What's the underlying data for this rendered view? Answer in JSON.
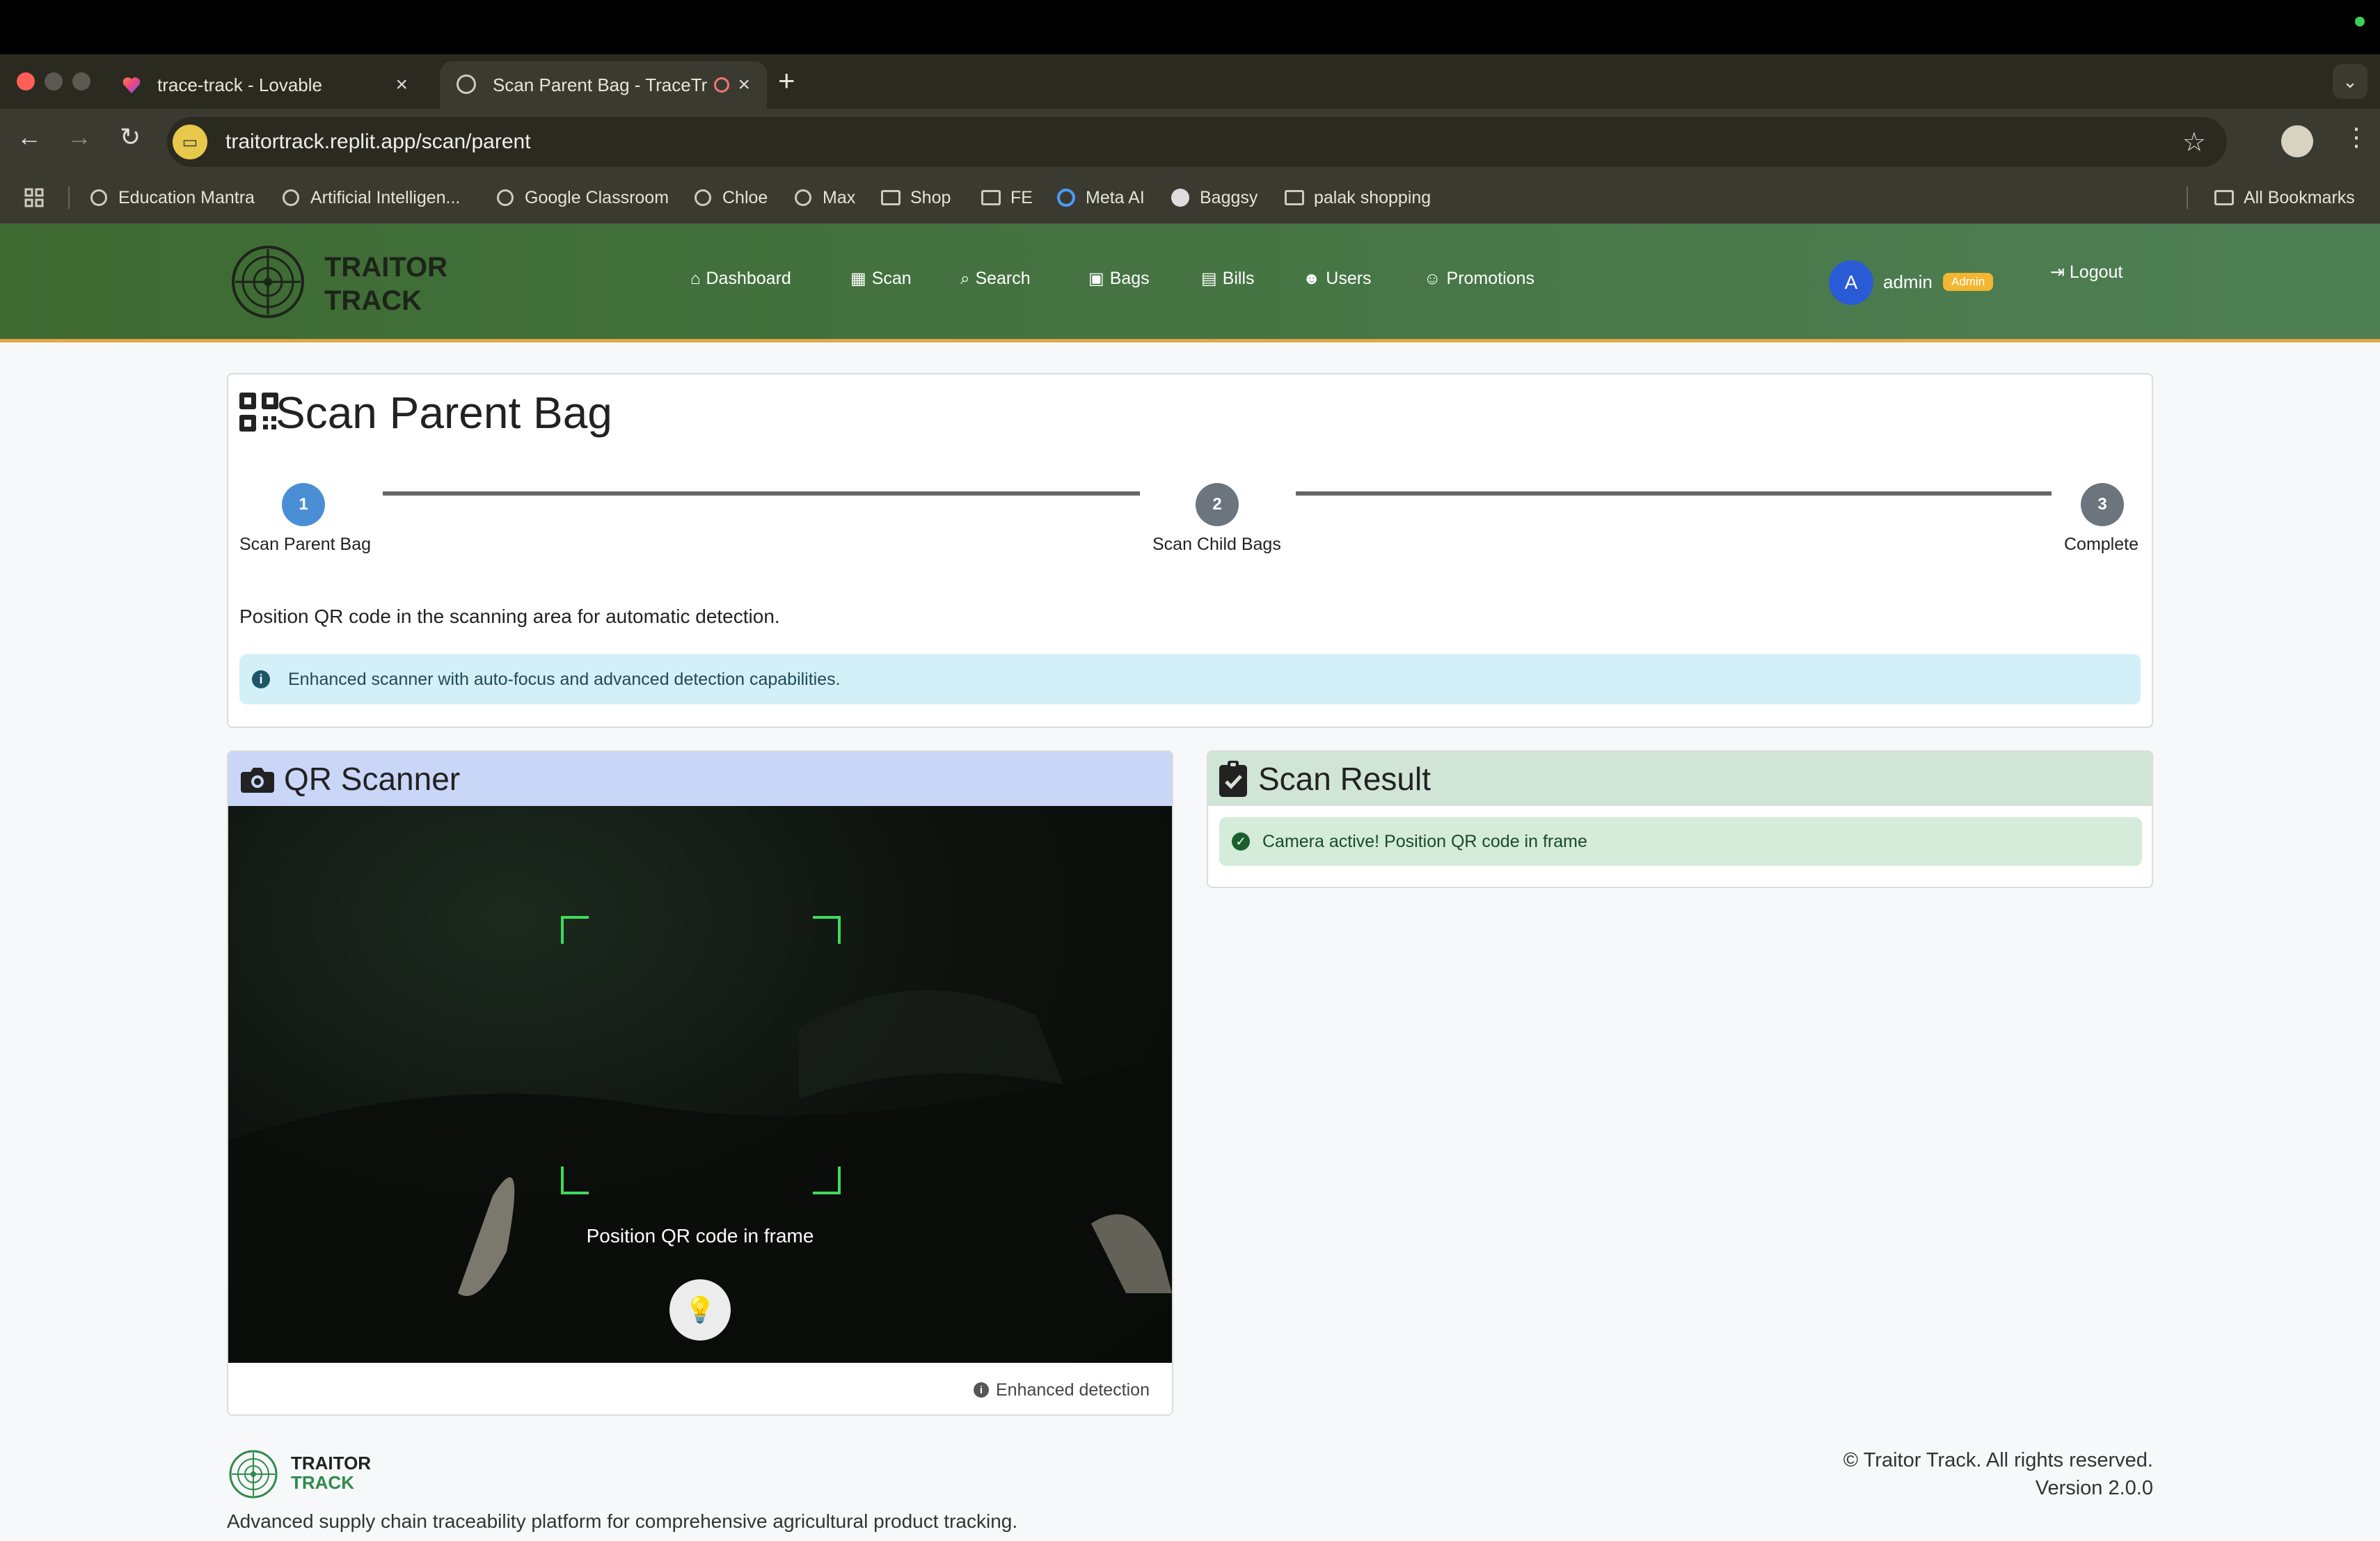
{
  "browser": {
    "tabs": [
      {
        "label": "trace-track - Lovable",
        "close": "×"
      },
      {
        "label": "Scan Parent Bag - TraceTr",
        "close": "×"
      }
    ],
    "new_tab": "+",
    "url": "traitortrack.replit.app/scan/parent",
    "bookmarks": [
      {
        "label": "Education Mantra",
        "icon": "globe-icon"
      },
      {
        "label": "Artificial Intelligen...",
        "icon": "globe-icon"
      },
      {
        "label": "Google Classroom",
        "icon": "globe-icon"
      },
      {
        "label": "Chloe",
        "icon": "globe-icon"
      },
      {
        "label": "Max",
        "icon": "globe-icon"
      },
      {
        "label": "Shop",
        "icon": "folder-icon"
      },
      {
        "label": "FE",
        "icon": "folder-icon"
      },
      {
        "label": "Meta AI",
        "icon": "meta-ai-icon"
      },
      {
        "label": "Baggsy",
        "icon": "openai-icon"
      },
      {
        "label": "palak shopping",
        "icon": "folder-icon"
      }
    ],
    "all_bookmarks": "All Bookmarks"
  },
  "app": {
    "brand_line1": "TRAITOR",
    "brand_line2": "TRACK",
    "nav": [
      {
        "label": "Dashboard",
        "icon": "home-icon"
      },
      {
        "label": "Scan",
        "icon": "qrcode-icon"
      },
      {
        "label": "Search",
        "icon": "search-icon"
      },
      {
        "label": "Bags",
        "icon": "boxes-icon"
      },
      {
        "label": "Bills",
        "icon": "file-icon"
      },
      {
        "label": "Users",
        "icon": "users-icon"
      },
      {
        "label": "Promotions",
        "icon": "user-gear-icon"
      }
    ],
    "user": {
      "avatar_letter": "A",
      "name": "admin",
      "role": "Admin"
    },
    "logout": "Logout",
    "colors": {
      "nav_start": "#3d6a31",
      "nav_end": "#4f7f55",
      "accent_border": "#e1a84a",
      "step_active": "#4a8fd6",
      "step_inactive": "#6c757d"
    }
  },
  "page": {
    "title": "Scan Parent Bag",
    "steps": [
      {
        "number": "1",
        "label": "Scan Parent Bag",
        "active": true
      },
      {
        "number": "2",
        "label": "Scan Child Bags",
        "active": false
      },
      {
        "number": "3",
        "label": "Complete",
        "active": false
      }
    ],
    "instruction": "Position QR code in the scanning area for automatic detection.",
    "info_alert": "Enhanced scanner with auto-focus and advanced detection capabilities."
  },
  "scanner": {
    "title": "QR Scanner",
    "camera_hint": "Position QR code in frame",
    "footer": "Enhanced detection"
  },
  "result": {
    "title": "Scan Result",
    "status": "Camera active! Position QR code in frame"
  },
  "footer": {
    "brand_line1": "TRAITOR",
    "brand_line2": "TRACK",
    "description": "Advanced supply chain traceability platform for comprehensive agricultural product tracking.",
    "copyright": "© Traitor Track. All rights reserved.",
    "version": "Version 2.0.0"
  }
}
